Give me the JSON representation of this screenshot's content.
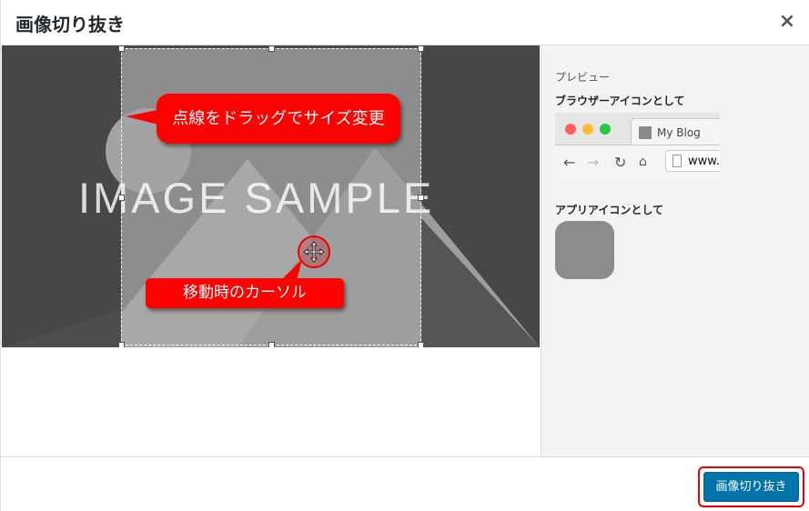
{
  "dialog": {
    "title": "画像切り抜き",
    "close_label": "×"
  },
  "stage": {
    "image_text": "IMAGE SAMPLE",
    "callout_resize": "点線をドラッグでサイズ変更",
    "callout_cursor": "移動時のカーソル",
    "cursor_icon": "move-cursor-icon"
  },
  "sidebar": {
    "preview_heading": "プレビュー",
    "browser_label": "ブラウザーアイコンとして",
    "browser_tab_title": "My Blog",
    "browser_url": "www.",
    "app_label": "アプリアイコンとして"
  },
  "footer": {
    "crop_button_label": "画像切り抜き"
  },
  "colors": {
    "primary_button": "#0073aa",
    "callout_red": "#ff0000",
    "close_dot": "#ff5f57",
    "minimize_dot": "#febc2e",
    "maximize_dot": "#28c840"
  }
}
